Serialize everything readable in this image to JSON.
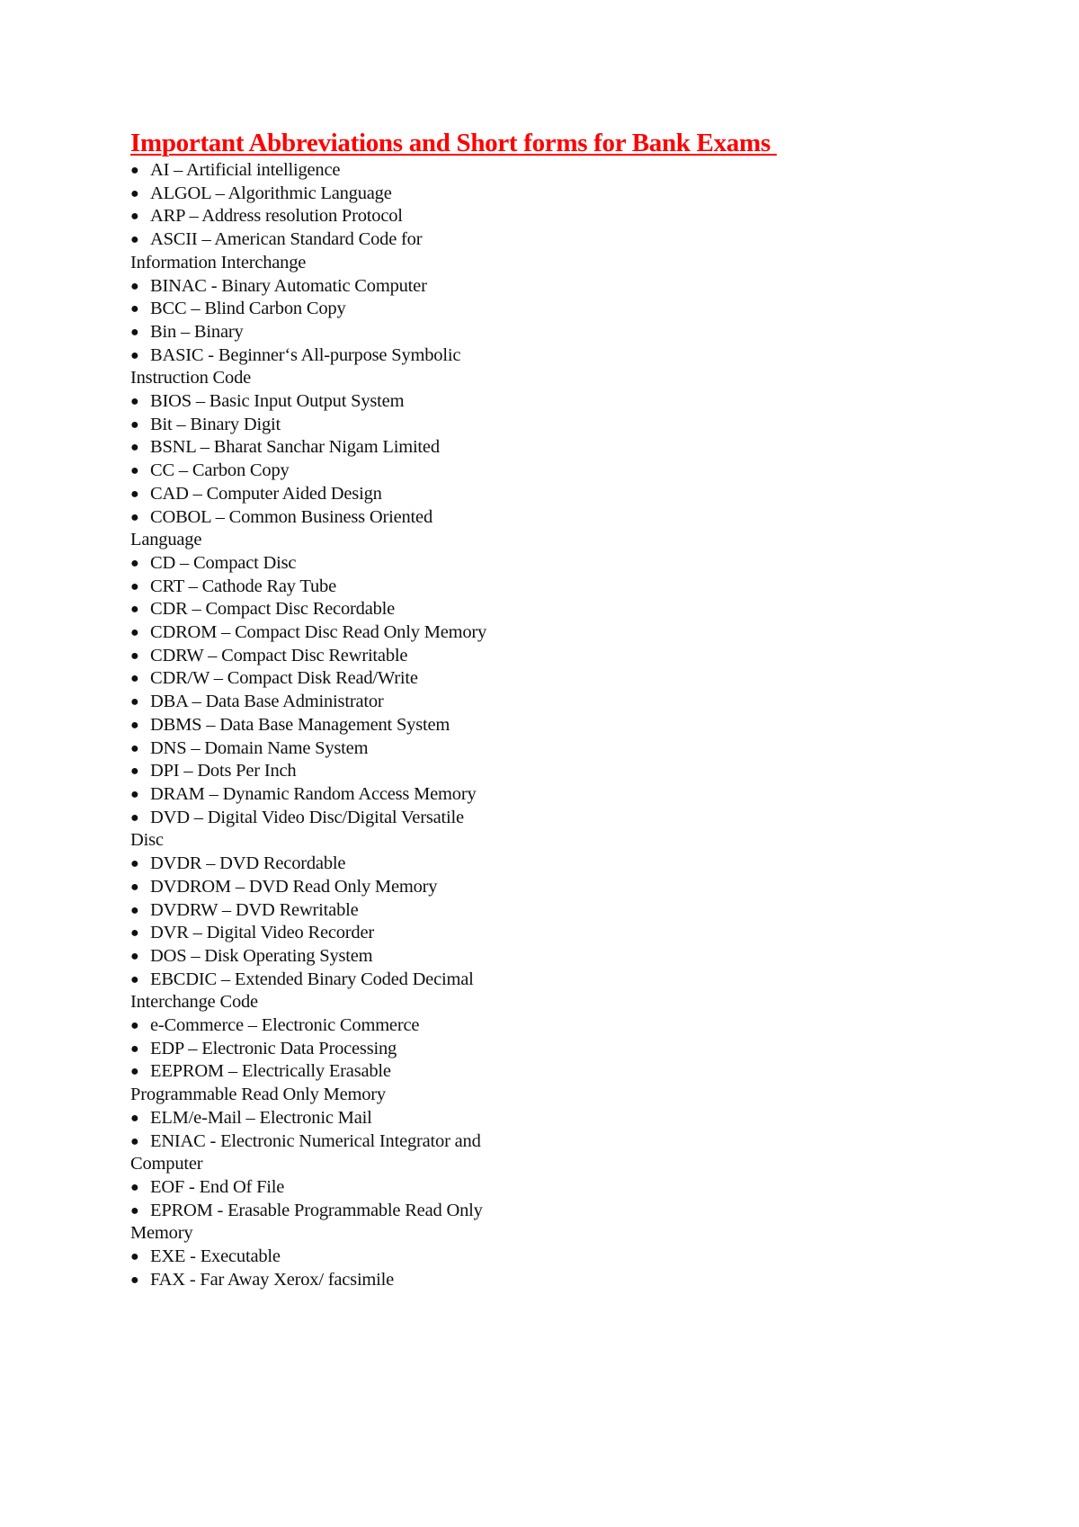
{
  "document": {
    "title": "Important Abbreviations and Short forms for Bank Exams ",
    "title_color": "#ff0000",
    "text_color": "#111111",
    "bullet_glyph": "●",
    "items": [
      {
        "lines": [
          "AI – Artificial intelligence"
        ]
      },
      {
        "lines": [
          "ALGOL – Algorithmic Language"
        ]
      },
      {
        "lines": [
          "ARP – Address resolution Protocol"
        ]
      },
      {
        "lines": [
          "ASCII – American Standard Code for",
          "Information Interchange"
        ]
      },
      {
        "lines": [
          "BINAC - Binary Automatic Computer"
        ]
      },
      {
        "lines": [
          "BCC – Blind Carbon Copy"
        ]
      },
      {
        "lines": [
          "Bin – Binary"
        ]
      },
      {
        "lines": [
          "BASIC - Beginner‘s All-purpose Symbolic",
          "Instruction Code"
        ]
      },
      {
        "lines": [
          "BIOS – Basic Input Output System"
        ]
      },
      {
        "lines": [
          "Bit – Binary Digit"
        ]
      },
      {
        "lines": [
          "BSNL – Bharat Sanchar Nigam Limited"
        ]
      },
      {
        "lines": [
          "CC – Carbon Copy"
        ]
      },
      {
        "lines": [
          "CAD – Computer Aided Design"
        ]
      },
      {
        "lines": [
          "COBOL – Common Business Oriented",
          "Language"
        ]
      },
      {
        "lines": [
          "CD – Compact Disc"
        ]
      },
      {
        "lines": [
          "CRT – Cathode Ray Tube"
        ]
      },
      {
        "lines": [
          "CDR – Compact Disc Recordable"
        ]
      },
      {
        "lines": [
          "CDROM – Compact Disc Read Only Memory"
        ]
      },
      {
        "lines": [
          "CDRW – Compact Disc Rewritable"
        ]
      },
      {
        "lines": [
          "CDR/W – Compact Disk Read/Write"
        ]
      },
      {
        "lines": [
          "DBA – Data Base Administrator"
        ]
      },
      {
        "lines": [
          "DBMS – Data Base Management System"
        ]
      },
      {
        "lines": [
          "DNS – Domain Name System"
        ]
      },
      {
        "lines": [
          "DPI – Dots Per Inch"
        ]
      },
      {
        "lines": [
          "DRAM – Dynamic Random Access Memory"
        ]
      },
      {
        "lines": [
          "DVD – Digital Video Disc/Digital Versatile",
          "Disc"
        ]
      },
      {
        "lines": [
          "DVDR – DVD Recordable"
        ]
      },
      {
        "lines": [
          "DVDROM – DVD Read Only Memory"
        ]
      },
      {
        "lines": [
          "DVDRW – DVD Rewritable"
        ]
      },
      {
        "lines": [
          "DVR – Digital Video Recorder"
        ]
      },
      {
        "lines": [
          "DOS – Disk Operating System"
        ]
      },
      {
        "lines": [
          "EBCDIC – Extended Binary Coded Decimal",
          "Interchange Code"
        ]
      },
      {
        "lines": [
          "e-Commerce – Electronic Commerce"
        ]
      },
      {
        "lines": [
          "EDP – Electronic Data Processing"
        ]
      },
      {
        "lines": [
          "EEPROM – Electrically Erasable",
          "Programmable Read Only Memory"
        ]
      },
      {
        "lines": [
          "ELM/e-Mail – Electronic Mail"
        ]
      },
      {
        "lines": [
          "ENIAC - Electronic Numerical Integrator and",
          "Computer"
        ]
      },
      {
        "lines": [
          "EOF - End Of File"
        ]
      },
      {
        "lines": [
          "EPROM - Erasable Programmable Read Only",
          "Memory"
        ]
      },
      {
        "lines": [
          "EXE - Executable"
        ]
      },
      {
        "lines": [
          "FAX - Far Away Xerox/ facsimile"
        ]
      }
    ]
  }
}
